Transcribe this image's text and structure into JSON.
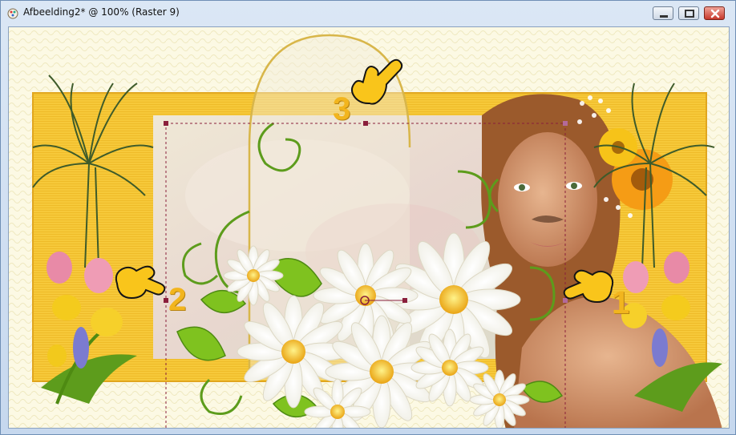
{
  "window": {
    "title": "Afbeelding2* @ 100% (Raster 9)"
  },
  "controls": {
    "minimize_icon": "minimize-icon",
    "maximize_icon": "restore-icon",
    "close_icon": "close-icon"
  },
  "markers": {
    "one": "1",
    "two": "2",
    "three": "3"
  },
  "colors": {
    "accent_gold": "#f2b51e",
    "frame_yellow": "#f6c93a",
    "selection_line": "#8a1f3b",
    "close_red": "#c7382c"
  }
}
